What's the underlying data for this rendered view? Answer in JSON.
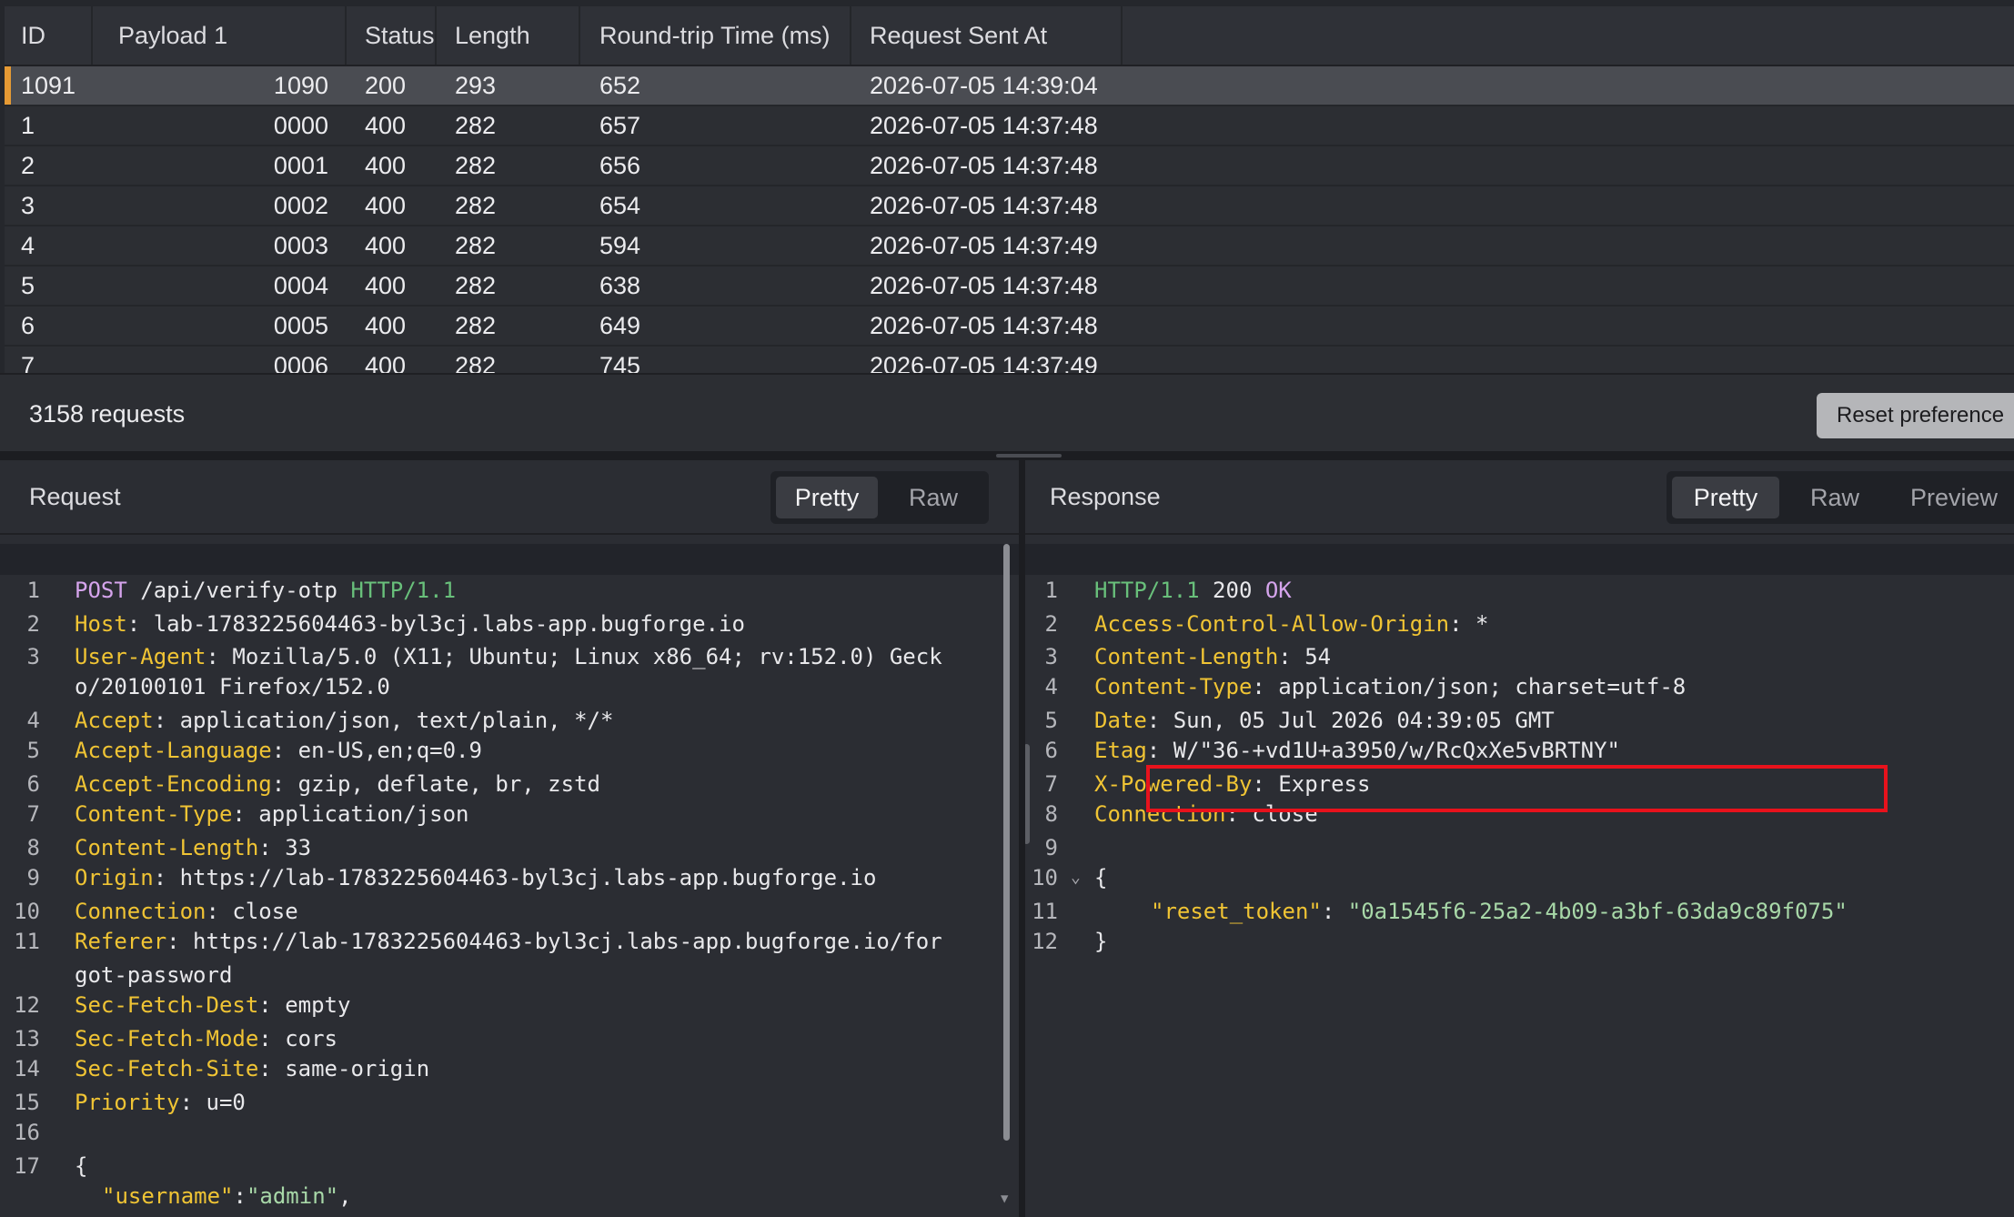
{
  "results": {
    "columns": [
      "ID",
      "Payload 1",
      "Status",
      "Length",
      "Round-trip Time (ms)",
      "Request Sent At"
    ],
    "rows": [
      {
        "id": "1091",
        "payload": "1090",
        "status": "200",
        "length": "293",
        "rtt": "652",
        "sent_at": "2026-07-05 14:39:04"
      },
      {
        "id": "1",
        "payload": "0000",
        "status": "400",
        "length": "282",
        "rtt": "657",
        "sent_at": "2026-07-05 14:37:48"
      },
      {
        "id": "2",
        "payload": "0001",
        "status": "400",
        "length": "282",
        "rtt": "656",
        "sent_at": "2026-07-05 14:37:48"
      },
      {
        "id": "3",
        "payload": "0002",
        "status": "400",
        "length": "282",
        "rtt": "654",
        "sent_at": "2026-07-05 14:37:48"
      },
      {
        "id": "4",
        "payload": "0003",
        "status": "400",
        "length": "282",
        "rtt": "594",
        "sent_at": "2026-07-05 14:37:49"
      },
      {
        "id": "5",
        "payload": "0004",
        "status": "400",
        "length": "282",
        "rtt": "638",
        "sent_at": "2026-07-05 14:37:48"
      },
      {
        "id": "6",
        "payload": "0005",
        "status": "400",
        "length": "282",
        "rtt": "649",
        "sent_at": "2026-07-05 14:37:48"
      },
      {
        "id": "7",
        "payload": "0006",
        "status": "400",
        "length": "282",
        "rtt": "745",
        "sent_at": "2026-07-05 14:37:49"
      }
    ],
    "selected_row_index": 0
  },
  "status_bar": {
    "request_count": "3158 requests",
    "reset_label": "Reset preference"
  },
  "request": {
    "title": "Request",
    "tabs": [
      "Pretty",
      "Raw"
    ],
    "active_tab": "Pretty"
  },
  "response": {
    "title": "Response",
    "tabs": [
      "Pretty",
      "Raw",
      "Preview"
    ],
    "active_tab": "Pretty"
  },
  "colors": {
    "accent_selected_row": "#e69a34",
    "header_name": "#f0c434",
    "method": "#d5a4ec",
    "protocol": "#69c07b",
    "highlight_box": "#e8121c"
  }
}
